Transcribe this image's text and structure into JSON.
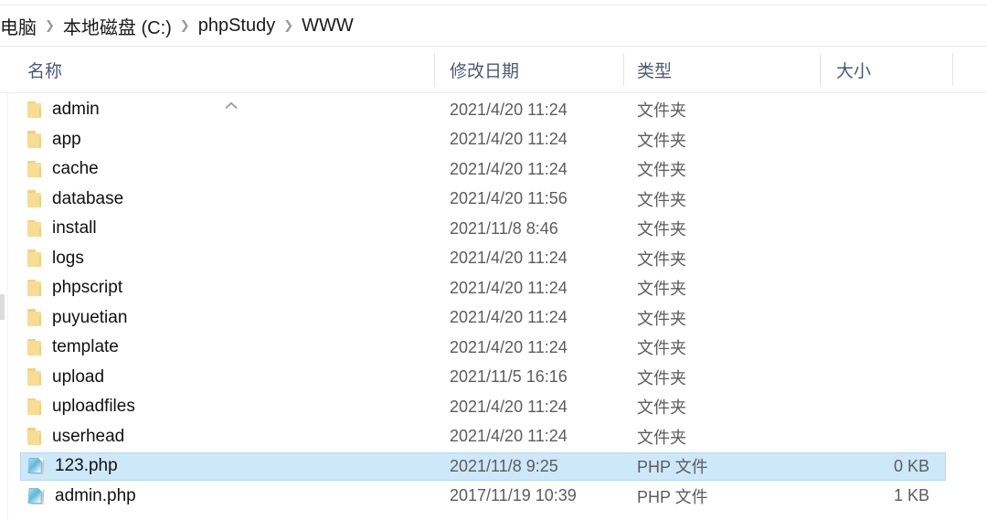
{
  "window": {
    "kind": "file-explorer"
  },
  "breadcrumb": {
    "separator": "❯",
    "items": [
      {
        "label": "电脑"
      },
      {
        "label": "本地磁盘 (C:)"
      },
      {
        "label": "phpStudy"
      },
      {
        "label": "WWW"
      }
    ]
  },
  "columns": {
    "name": {
      "label": "名称",
      "sort_indicator": "˄"
    },
    "date": {
      "label": "修改日期"
    },
    "type": {
      "label": "类型"
    },
    "size": {
      "label": "大小"
    }
  },
  "colors": {
    "selection_fill": "#cde8f9",
    "selection_border": "#b5d9ef",
    "header_text": "#4a5a78",
    "meta_text": "#5c5c5c",
    "folder_icon": "#f7dc94",
    "php_icon": "#5fb8dd"
  },
  "files": [
    {
      "name": "admin",
      "date": "2021/4/20 11:24",
      "type": "文件夹",
      "size": "",
      "icon": "folder-icon",
      "selected": false
    },
    {
      "name": "app",
      "date": "2021/4/20 11:24",
      "type": "文件夹",
      "size": "",
      "icon": "folder-icon",
      "selected": false
    },
    {
      "name": "cache",
      "date": "2021/4/20 11:24",
      "type": "文件夹",
      "size": "",
      "icon": "folder-icon",
      "selected": false
    },
    {
      "name": "database",
      "date": "2021/4/20 11:56",
      "type": "文件夹",
      "size": "",
      "icon": "folder-icon",
      "selected": false
    },
    {
      "name": "install",
      "date": "2021/11/8 8:46",
      "type": "文件夹",
      "size": "",
      "icon": "folder-icon",
      "selected": false
    },
    {
      "name": "logs",
      "date": "2021/4/20 11:24",
      "type": "文件夹",
      "size": "",
      "icon": "folder-icon",
      "selected": false
    },
    {
      "name": "phpscript",
      "date": "2021/4/20 11:24",
      "type": "文件夹",
      "size": "",
      "icon": "folder-icon",
      "selected": false
    },
    {
      "name": "puyuetian",
      "date": "2021/4/20 11:24",
      "type": "文件夹",
      "size": "",
      "icon": "folder-icon",
      "selected": false
    },
    {
      "name": "template",
      "date": "2021/4/20 11:24",
      "type": "文件夹",
      "size": "",
      "icon": "folder-icon",
      "selected": false
    },
    {
      "name": "upload",
      "date": "2021/11/5 16:16",
      "type": "文件夹",
      "size": "",
      "icon": "folder-icon",
      "selected": false
    },
    {
      "name": "uploadfiles",
      "date": "2021/4/20 11:24",
      "type": "文件夹",
      "size": "",
      "icon": "folder-icon",
      "selected": false
    },
    {
      "name": "userhead",
      "date": "2021/4/20 11:24",
      "type": "文件夹",
      "size": "",
      "icon": "folder-icon",
      "selected": false
    },
    {
      "name": "123.php",
      "date": "2021/11/8 9:25",
      "type": "PHP 文件",
      "size": "0 KB",
      "icon": "php-file-icon",
      "selected": true
    },
    {
      "name": "admin.php",
      "date": "2017/11/19 10:39",
      "type": "PHP 文件",
      "size": "1 KB",
      "icon": "php-file-icon",
      "selected": false
    }
  ]
}
